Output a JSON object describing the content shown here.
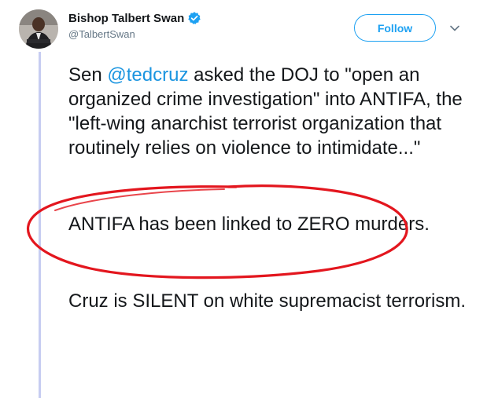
{
  "author": {
    "display_name": "Bishop Talbert Swan",
    "handle": "@TalbertSwan",
    "verified": true
  },
  "actions": {
    "follow_label": "Follow",
    "menu_icon": "chevron-down-icon"
  },
  "tweet": {
    "p1_prefix": "Sen ",
    "p1_mention": "@tedcruz",
    "p1_suffix": " asked the DOJ to \"open an organized crime investigation\" into ANTIFA, the \"left-wing anarchist terrorist organization that routinely relies on violence to intimidate...\"",
    "p2": "ANTIFA has been linked to ZERO murders.",
    "p3": "Cruz is SILENT on white supremacist terrorism."
  },
  "colors": {
    "accent": "#1da1f2",
    "mention": "#1b95e0",
    "annotation_circle": "#e3161e",
    "thread_line": "#c7cdf1"
  }
}
